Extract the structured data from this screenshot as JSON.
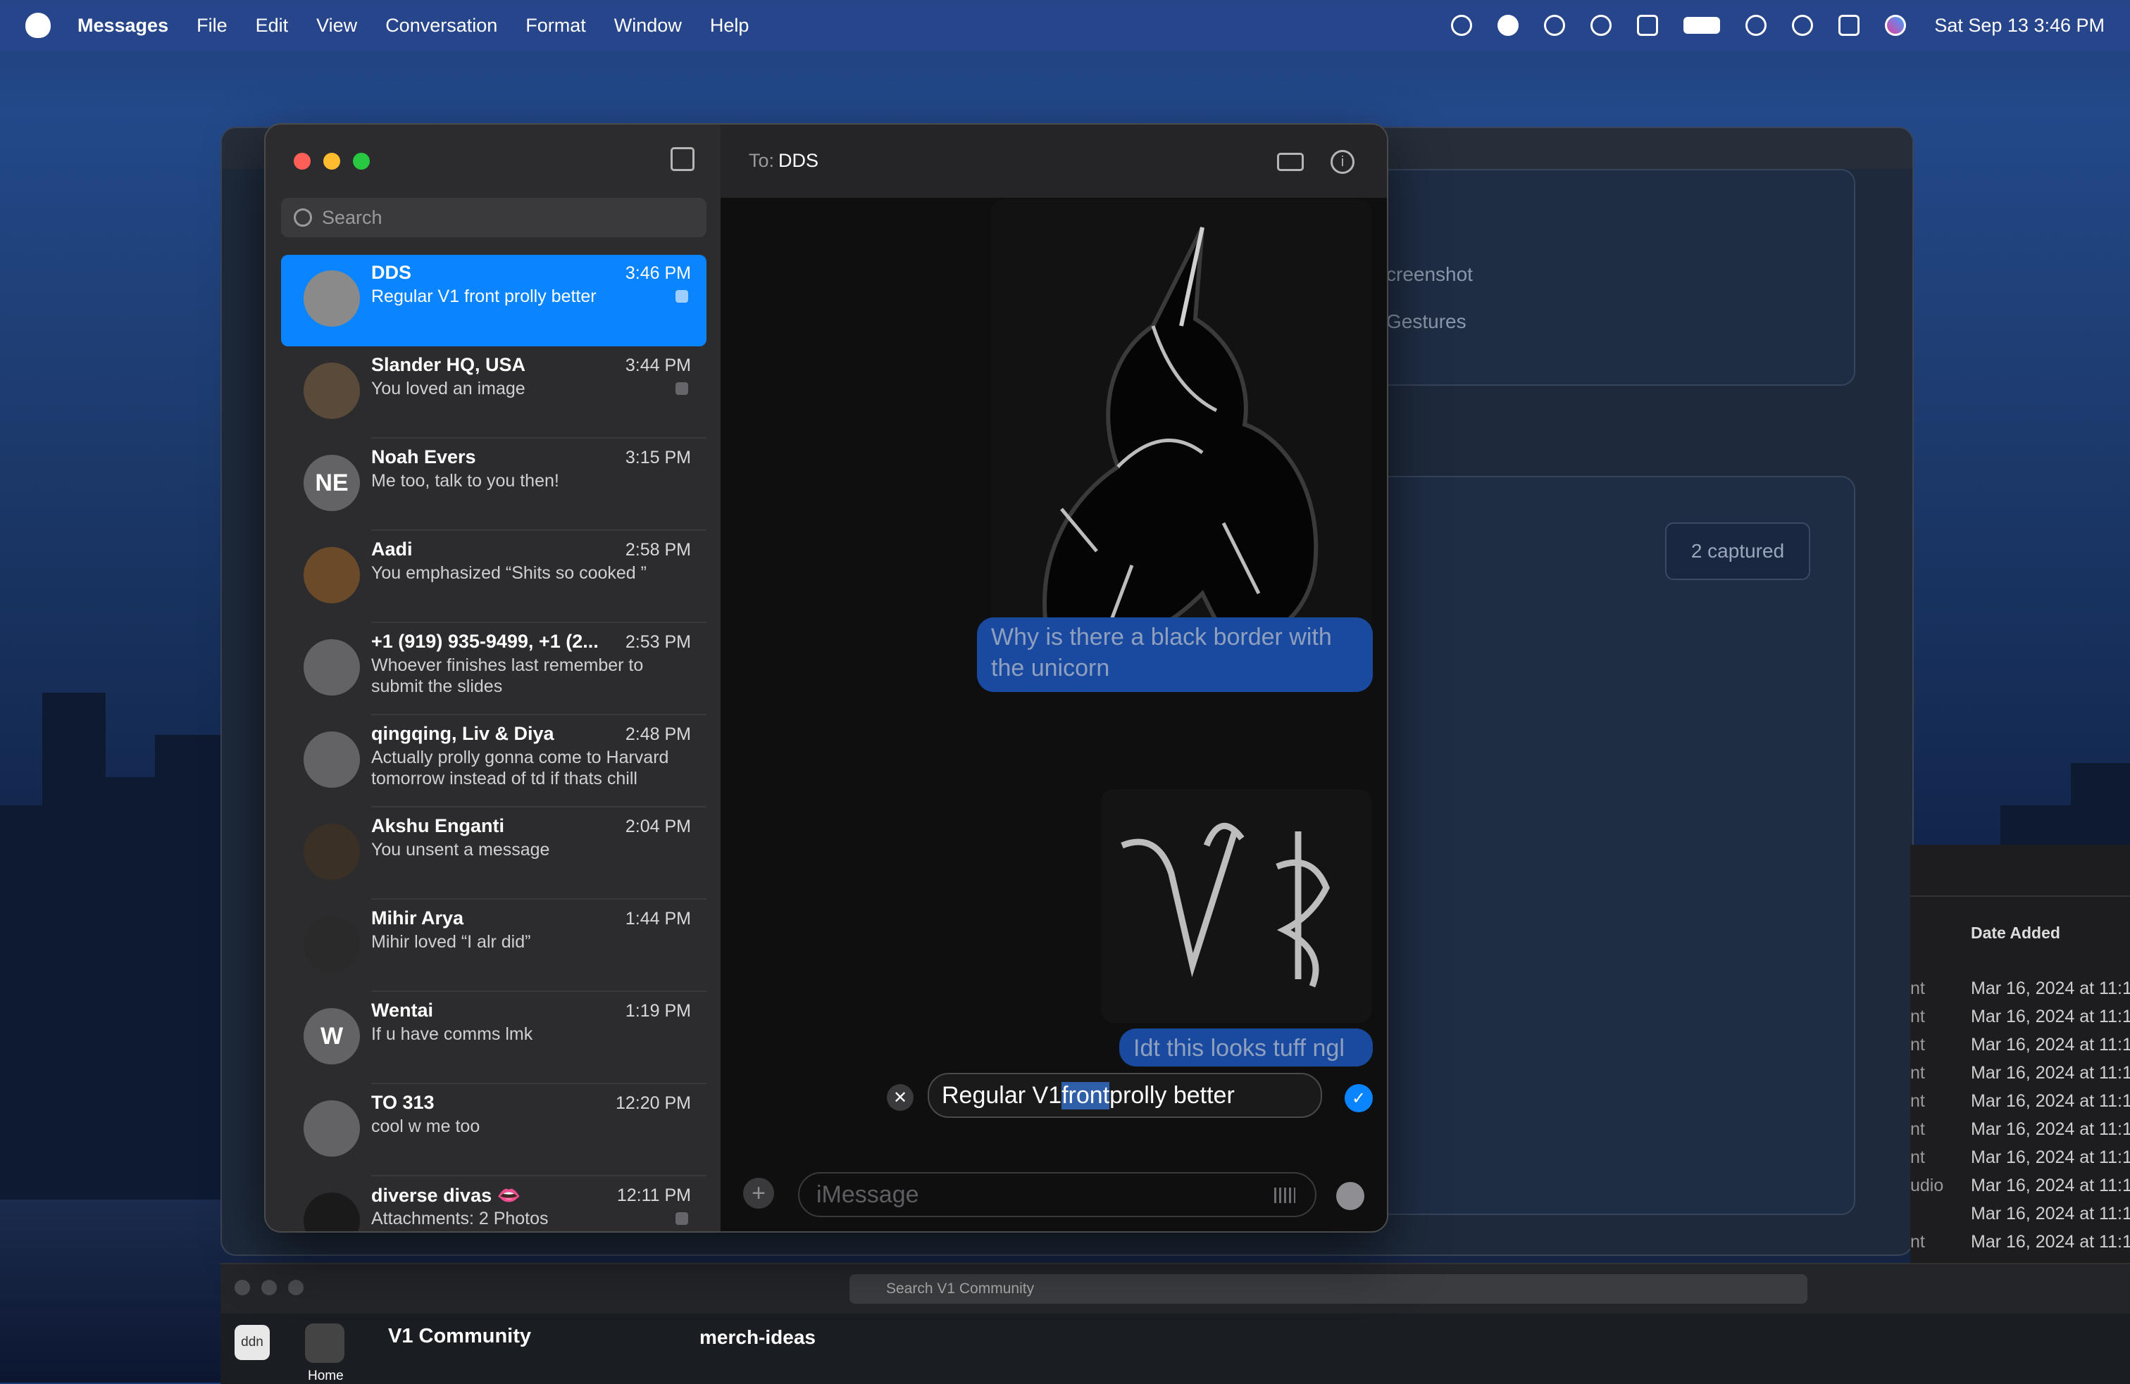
{
  "menubar": {
    "app": "Messages",
    "menus": [
      "File",
      "Edit",
      "View",
      "Conversation",
      "Format",
      "Window",
      "Help"
    ],
    "clock": "Sat Sep 13  3:46 PM",
    "icons": [
      "time-machine-icon",
      "checkmark-icon",
      "play-icon",
      "headphones-icon",
      "display-icon",
      "battery-icon",
      "wifi-icon",
      "search-icon",
      "control-center-icon",
      "siri-icon"
    ]
  },
  "background_window": {
    "items": [
      "creenshot",
      "Gestures"
    ],
    "captured_label": "2 captured"
  },
  "finder": {
    "column": "Date Added",
    "rows": [
      {
        "kind": "nt",
        "date": "Mar 16, 2024 at 11:1"
      },
      {
        "kind": "nt",
        "date": "Mar 16, 2024 at 11:1"
      },
      {
        "kind": "nt",
        "date": "Mar 16, 2024 at 11:1"
      },
      {
        "kind": "nt",
        "date": "Mar 16, 2024 at 11:1"
      },
      {
        "kind": "nt",
        "date": "Mar 16, 2024 at 11:1"
      },
      {
        "kind": "nt",
        "date": "Mar 16, 2024 at 11:1"
      },
      {
        "kind": "nt",
        "date": "Mar 16, 2024 at 11:1"
      },
      {
        "kind": "udio",
        "date": "Mar 16, 2024 at 11:1"
      },
      {
        "kind": "",
        "date": "Mar 16, 2024 at 11:1"
      },
      {
        "kind": "nt",
        "date": "Mar 16, 2024 at 11:1"
      }
    ]
  },
  "slack": {
    "search_placeholder": "Search V1 Community",
    "workspace": "V1 Community",
    "channel": "merch-ideas",
    "user_badge": "ddn",
    "home_label": "Home"
  },
  "messages": {
    "search_placeholder": "Search",
    "conversations": [
      {
        "name": "DDS",
        "time": "3:46 PM",
        "preview": "Regular V1 front prolly better",
        "initials": "",
        "selected": true,
        "muted": true
      },
      {
        "name": "Slander HQ, USA",
        "time": "3:44 PM",
        "preview": "You loved an image",
        "initials": "",
        "selected": false,
        "muted": true
      },
      {
        "name": "Noah Evers",
        "time": "3:15 PM",
        "preview": "Me too, talk to you then!",
        "initials": "NE",
        "selected": false,
        "muted": false
      },
      {
        "name": "Aadi",
        "time": "2:58 PM",
        "preview": "You emphasized “Shits so cooked ”",
        "initials": "",
        "selected": false,
        "muted": false
      },
      {
        "name": "+1 (919) 935-9499, +1 (2...",
        "time": "2:53 PM",
        "preview": "Whoever finishes last remember to submit the slides",
        "initials": "",
        "selected": false,
        "muted": false
      },
      {
        "name": "qingqing, Liv & Diya",
        "time": "2:48 PM",
        "preview": "Actually prolly gonna come to Harvard tomorrow instead of td if thats chill",
        "initials": "",
        "selected": false,
        "muted": false
      },
      {
        "name": "Akshu Enganti",
        "time": "2:04 PM",
        "preview": "You unsent a message",
        "initials": "",
        "selected": false,
        "muted": false
      },
      {
        "name": "Mihir Arya",
        "time": "1:44 PM",
        "preview": "Mihir loved “I alr did”",
        "initials": "",
        "selected": false,
        "muted": false
      },
      {
        "name": "Wentai",
        "time": "1:19 PM",
        "preview": "If u have comms lmk",
        "initials": "W",
        "selected": false,
        "muted": false
      },
      {
        "name": "TO 313",
        "time": "12:20 PM",
        "preview": "cool w me too",
        "initials": "",
        "selected": false,
        "muted": false
      },
      {
        "name": "diverse divas 👄",
        "time": "12:11 PM",
        "preview": "Attachments: 2 Photos",
        "initials": "",
        "selected": false,
        "muted": true
      }
    ],
    "chat": {
      "to_label": "To:",
      "recipient": "DDS",
      "bubble1": "Why is there a black border with the unicorn",
      "bubble2": "Idt this looks tuff ngl",
      "edit_before": "Regular V1 ",
      "edit_highlight": "front",
      "edit_after": " prolly better",
      "compose_placeholder": "iMessage"
    }
  }
}
